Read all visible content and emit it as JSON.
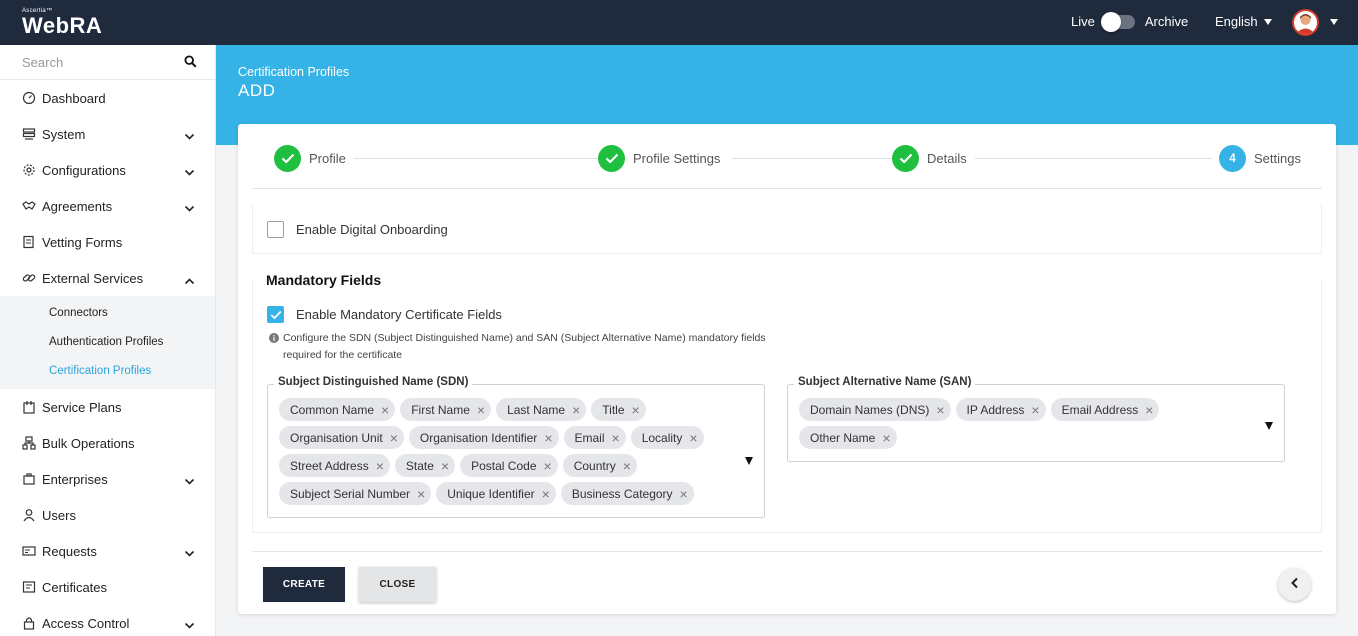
{
  "header": {
    "brand_small": "Ascertia™",
    "brand": "WebRA",
    "live_label": "Live",
    "archive_label": "Archive",
    "language": "English"
  },
  "sidebar": {
    "search_placeholder": "Search",
    "items": [
      {
        "label": "Dashboard",
        "icon": "dashboard-icon",
        "expandable": false
      },
      {
        "label": "System",
        "icon": "system-icon",
        "expandable": true
      },
      {
        "label": "Configurations",
        "icon": "gear-icon",
        "expandable": true
      },
      {
        "label": "Agreements",
        "icon": "handshake-icon",
        "expandable": true
      },
      {
        "label": "Vetting Forms",
        "icon": "form-icon",
        "expandable": false
      },
      {
        "label": "External Services",
        "icon": "link-icon",
        "expandable": true,
        "expanded": true
      },
      {
        "label": "Service Plans",
        "icon": "plans-icon",
        "expandable": false
      },
      {
        "label": "Bulk Operations",
        "icon": "bulk-icon",
        "expandable": false
      },
      {
        "label": "Enterprises",
        "icon": "enterprise-icon",
        "expandable": true
      },
      {
        "label": "Users",
        "icon": "user-icon",
        "expandable": false
      },
      {
        "label": "Requests",
        "icon": "requests-icon",
        "expandable": true
      },
      {
        "label": "Certificates",
        "icon": "certificate-icon",
        "expandable": false
      },
      {
        "label": "Access Control",
        "icon": "lock-icon",
        "expandable": true
      }
    ],
    "sub_items": [
      {
        "label": "Connectors",
        "active": false
      },
      {
        "label": "Authentication Profiles",
        "active": false
      },
      {
        "label": "Certification Profiles",
        "active": true
      }
    ]
  },
  "page": {
    "breadcrumb": "Certification Profiles",
    "title": "ADD"
  },
  "stepper": {
    "steps": [
      {
        "label": "Profile",
        "status": "done"
      },
      {
        "label": "Profile Settings",
        "status": "done"
      },
      {
        "label": "Details",
        "status": "done"
      },
      {
        "label": "Settings",
        "status": "current",
        "number": "4"
      }
    ]
  },
  "form": {
    "digital_onboarding_label": "Enable Digital Onboarding",
    "digital_onboarding_checked": false,
    "mandatory_title": "Mandatory Fields",
    "mandatory_cert_label": "Enable Mandatory Certificate Fields",
    "mandatory_cert_checked": true,
    "info_line1": "Configure the SDN (Subject Distinguished Name) and SAN (Subject Alternative Name) mandatory fields",
    "info_line2": "required for the certificate",
    "sdn": {
      "legend": "Subject Distinguished Name (SDN)",
      "chips": [
        "Common Name",
        "First Name",
        "Last Name",
        "Title",
        "Organisation Unit",
        "Organisation Identifier",
        "Email",
        "Locality",
        "Street Address",
        "State",
        "Postal Code",
        "Country",
        "Subject Serial Number",
        "Unique Identifier",
        "Business Category"
      ]
    },
    "san": {
      "legend": "Subject Alternative Name (SAN)",
      "chips": [
        "Domain Names (DNS)",
        "IP Address",
        "Email Address",
        "Other Name"
      ]
    }
  },
  "footer": {
    "create_label": "CREATE",
    "close_label": "CLOSE"
  },
  "colors": {
    "topbar": "#1f2a3c",
    "accent": "#35b3e6",
    "success": "#1fbf3f"
  }
}
